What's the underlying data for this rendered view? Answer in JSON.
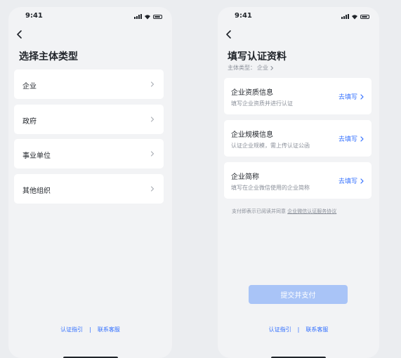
{
  "left": {
    "status_time": "9:41",
    "title": "选择主体类型",
    "options": [
      {
        "label": "企业"
      },
      {
        "label": "政府"
      },
      {
        "label": "事业单位"
      },
      {
        "label": "其他组织"
      }
    ],
    "footer": {
      "guide": "认证指引",
      "separator": "|",
      "contact": "联系客服"
    }
  },
  "right": {
    "status_time": "9:41",
    "title": "填写认证资料",
    "subject_label": "主体类型：",
    "subject_value": "企业",
    "cards": [
      {
        "title": "企业资质信息",
        "desc": "填写企业资质并进行认证",
        "action": "去填写"
      },
      {
        "title": "企业规模信息",
        "desc": "认证企业规模，需上传认证公函",
        "action": "去填写"
      },
      {
        "title": "企业简称",
        "desc": "填写在企业微信使用的企业简称",
        "action": "去填写"
      }
    ],
    "agreement_text": "支付即表示已阅读并同意",
    "agreement_link": "企业微信认证服务协议",
    "submit_label": "提交并支付",
    "footer": {
      "guide": "认证指引",
      "separator": "|",
      "contact": "联系客服"
    }
  },
  "colors": {
    "accent": "#3370ff",
    "button_disabled": "#a9c4f7",
    "background": "#f2f3f5"
  },
  "icons": [
    "signal-icon",
    "wifi-icon",
    "battery-icon",
    "back-arrow-icon",
    "chevron-right-icon"
  ]
}
